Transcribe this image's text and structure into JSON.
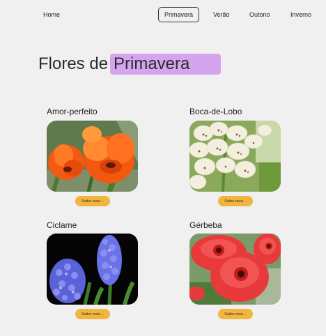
{
  "nav": {
    "home": "Home",
    "primavera": "Primavera",
    "verao": "Verão",
    "outono": "Outono",
    "inverno": "Inverno"
  },
  "header": {
    "title_prefix": "Flores de",
    "title_highlight": "Primavera"
  },
  "cards": [
    {
      "name": "Amor-perfeito",
      "button": "Saiba mais..."
    },
    {
      "name": "Boca-de-Lobo",
      "button": "Saiba mais..."
    },
    {
      "name": "Ciclame",
      "button": "Saiba mais..."
    },
    {
      "name": "Gérbeba",
      "button": "Saiba mais..."
    }
  ],
  "colors": {
    "background": "#f0f0f0",
    "highlight": "#d5a4ee",
    "button": "#f2b53d"
  }
}
